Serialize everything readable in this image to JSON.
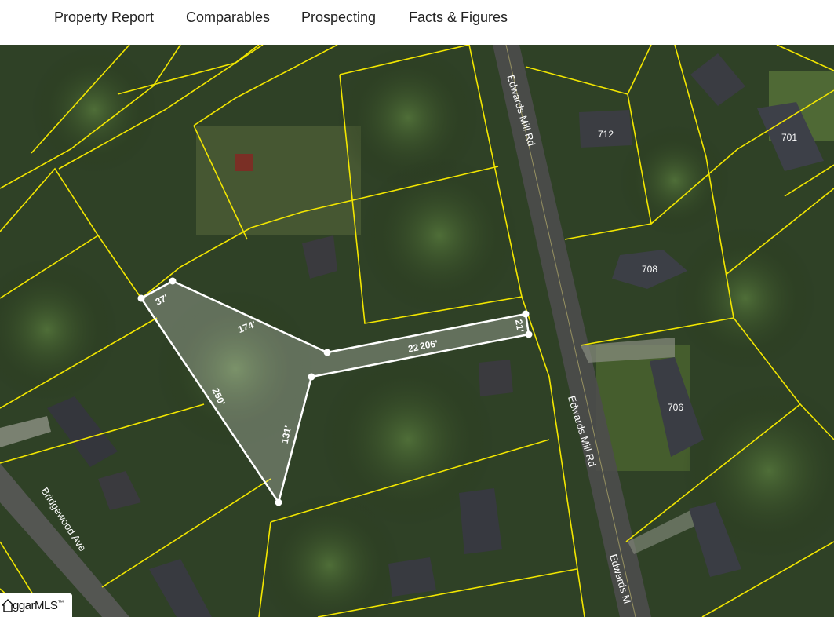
{
  "nav": {
    "tabs": [
      {
        "label": "Property Report"
      },
      {
        "label": "Comparables"
      },
      {
        "label": "Prospecting"
      },
      {
        "label": "Facts & Figures"
      }
    ]
  },
  "map": {
    "type": "aerial-parcel-map",
    "parcel_line_color": "#f2e600",
    "selection_color": "#ffffff",
    "streets": [
      "Edwards Mill Rd",
      "Edwards Mill Rd",
      "Edwards M",
      "Bridgewood Ave"
    ],
    "house_numbers": [
      "712",
      "701",
      "708",
      "706"
    ],
    "measurements": [
      "37'",
      "174'",
      "22",
      "206'",
      "21'",
      "250'",
      "131'"
    ]
  },
  "logo": {
    "text": "ggarMLS",
    "tm": "™"
  }
}
